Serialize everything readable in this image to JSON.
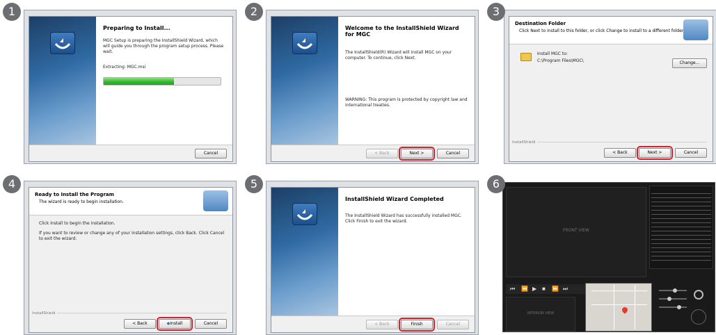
{
  "steps": [
    "1",
    "2",
    "3",
    "4",
    "5",
    "6"
  ],
  "panel1": {
    "title": "Preparing to Install...",
    "body": "MGC Setup is preparing the InstallShield Wizard, which will guide you through the program setup process. Please wait.",
    "extracting": "Extracting: MGC.msi",
    "progress_fraction": 0.6,
    "cancel": "Cancel"
  },
  "panel2": {
    "title": "Welcome to the InstallShield Wizard for MGC",
    "body": "The InstallShield(R) Wizard will install MGC on your computer. To continue, click Next.",
    "warning": "WARNING: This program is protected by copyright law and international treaties.",
    "back": "< Back",
    "next": "Next >",
    "cancel": "Cancel"
  },
  "panel3": {
    "title": "Destination Folder",
    "subtitle": "Click Next to install to this folder, or click Change to install to a different folder.",
    "install_to": "Install MGC to:",
    "path": "C:\\Program Files\\MGC\\",
    "change": "Change...",
    "installshield": "InstallShield",
    "back": "< Back",
    "next": "Next >",
    "cancel": "Cancel"
  },
  "panel4": {
    "title": "Ready to Install the Program",
    "subtitle": "The wizard is ready to begin installation.",
    "line1": "Click Install to begin the installation.",
    "line2": "If you want to review or change any of your installation settings, click Back. Click Cancel to exit the wizard.",
    "installshield": "InstallShield",
    "back": "< Back",
    "install": "Install",
    "cancel": "Cancel"
  },
  "panel5": {
    "title": "InstallShield Wizard Completed",
    "body": "The InstallShield Wizard has successfully installed MGC. Click Finish to exit the wizard.",
    "back": "< Back",
    "finish": "Finish",
    "cancel": "Cancel"
  },
  "panel6": {
    "front_view": "FRONT VIEW",
    "interior_view": "INTERIOR VIEW",
    "table_rows": 17
  },
  "colors": {
    "highlight": "#d8202a",
    "progress": "#2fb52b",
    "side": "#2f6aa2"
  }
}
